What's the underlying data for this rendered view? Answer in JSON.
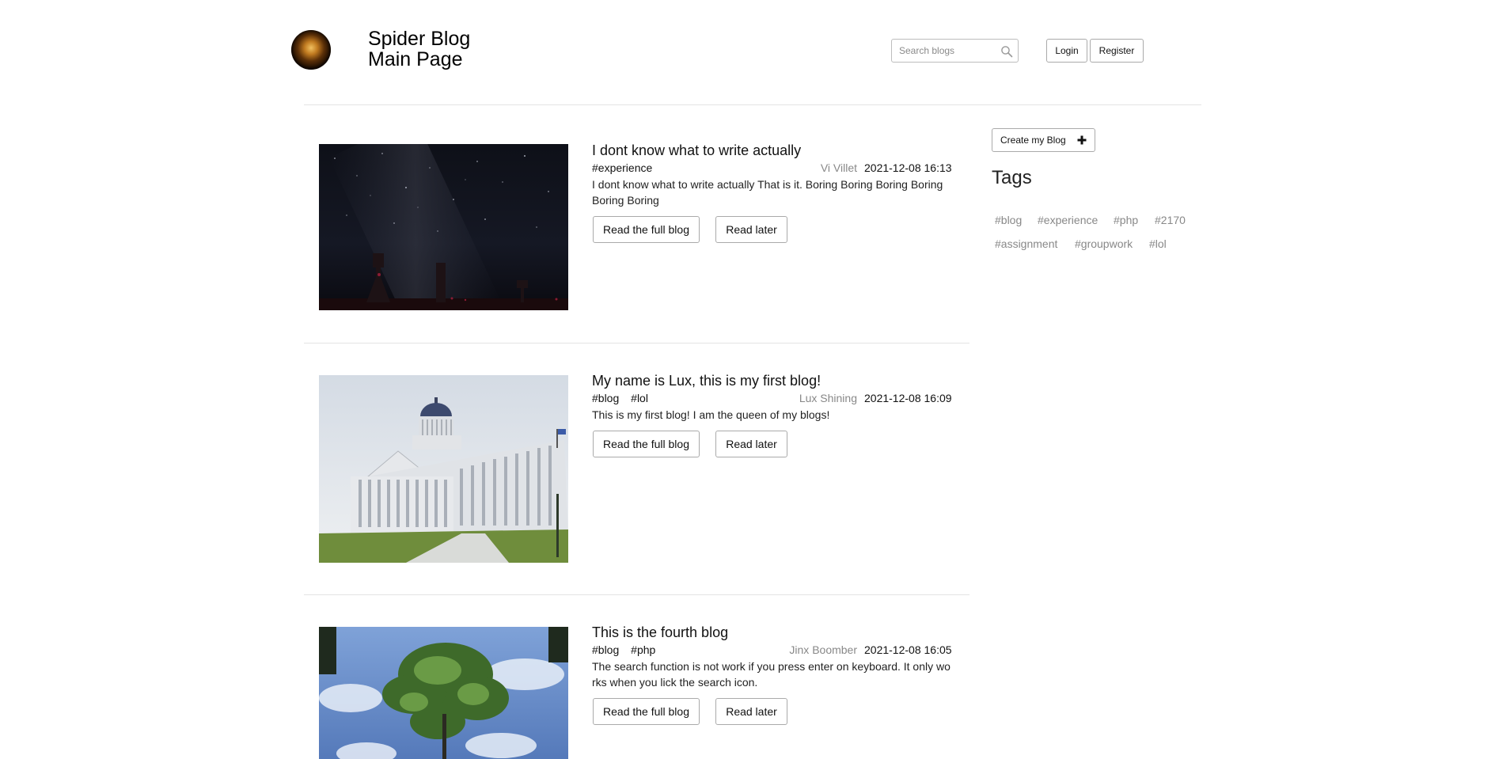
{
  "header": {
    "title_line1": "Spider Blog",
    "title_line2": "Main Page",
    "search_placeholder": "Search blogs",
    "login_label": "Login",
    "register_label": "Register"
  },
  "sidebar": {
    "create_label": "Create my Blog",
    "create_icon": "plus-icon",
    "tags_heading": "Tags",
    "tags": [
      "#blog",
      "#experience",
      "#php",
      "#2170",
      "#assignment",
      "#groupwork",
      "#lol"
    ]
  },
  "posts": [
    {
      "title": "I dont know what to write actually",
      "tags": [
        "#experience"
      ],
      "author": "Vi Villet",
      "date": "2021-12-08 16:13",
      "body": "I dont know what to write actually That is it. Boring Boring Boring Boring Boring Boring",
      "image": "night-sky-photo"
    },
    {
      "title": "My name is Lux, this is my first blog!",
      "tags": [
        "#blog",
        "#lol"
      ],
      "author": "Lux Shining",
      "date": "2021-12-08 16:09",
      "body": "This is my first blog! I am the queen of my blogs!",
      "image": "capitol-building-photo"
    },
    {
      "title": "This is the fourth blog",
      "tags": [
        "#blog",
        "#php"
      ],
      "author": "Jinx Boomber",
      "date": "2021-12-08 16:05",
      "body": "The search function is not work if you press enter on keyboard. It only wo rks when you lick the search icon.",
      "image": "tree-reflection-photo"
    }
  ],
  "post_actions": {
    "read_full": "Read the full blog",
    "read_later": "Read later"
  }
}
